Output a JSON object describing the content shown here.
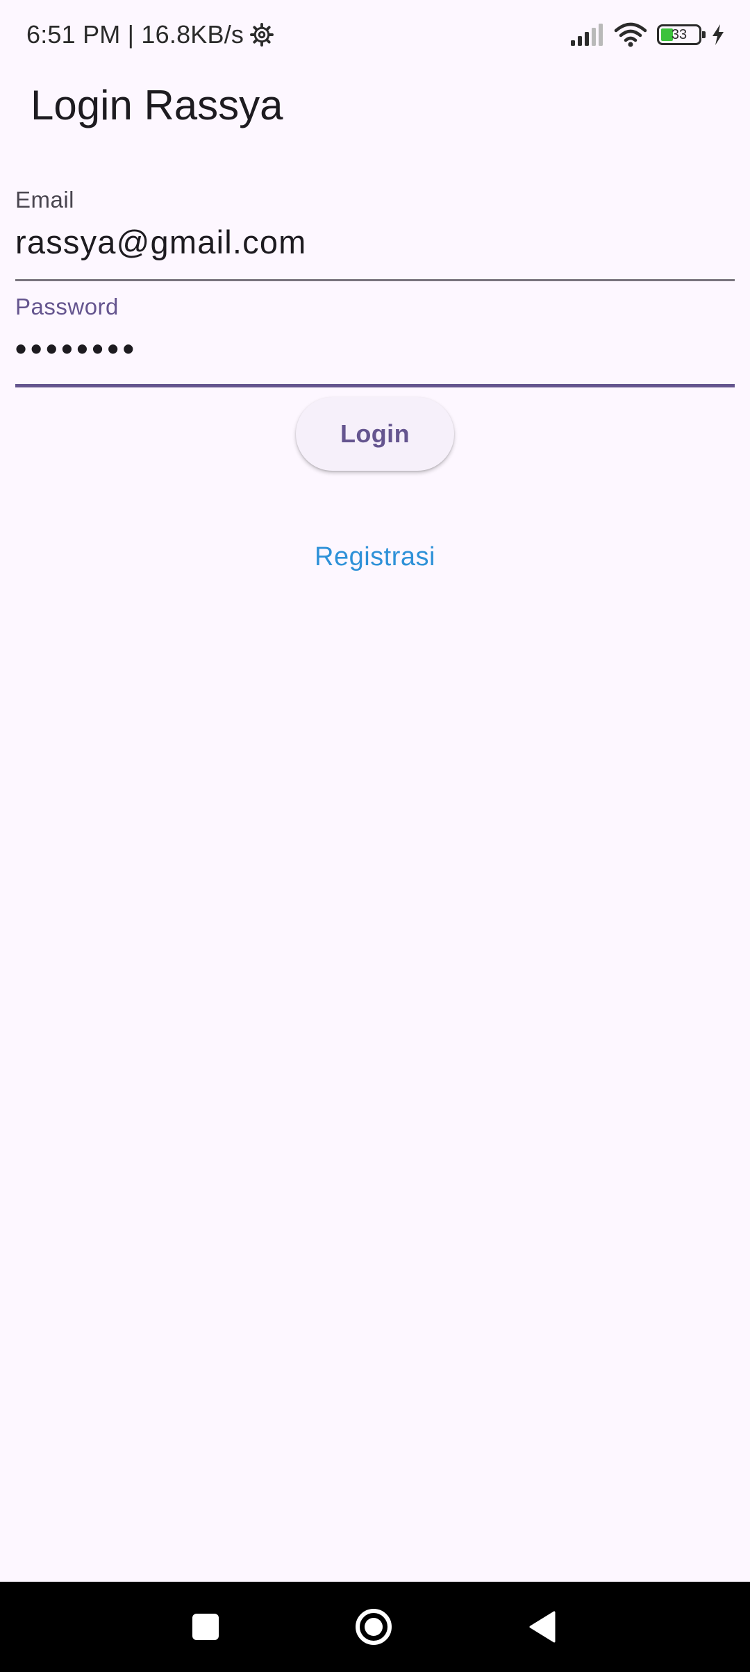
{
  "status_bar": {
    "time_speed": "6:51 PM | 16.8KB/s",
    "battery_level": "33",
    "battery_fraction": 0.33,
    "icons": [
      "gear-icon",
      "signal-icon",
      "wifi-icon",
      "battery-icon",
      "charging-icon"
    ]
  },
  "app_bar": {
    "title": "Login Rassya"
  },
  "form": {
    "email": {
      "label": "Email",
      "value": "rassya@gmail.com"
    },
    "password": {
      "label": "Password",
      "value": "••••••••"
    }
  },
  "buttons": {
    "login_label": "Login",
    "register_label": "Registrasi"
  },
  "nav_bar": {
    "icons": [
      "recents-icon",
      "home-icon",
      "back-icon"
    ]
  },
  "colors": {
    "background": "#FDF7FF",
    "primary": "#65558F",
    "link": "#2E91D8",
    "battery_fill": "#3CC23C",
    "nav_bar": "#000000"
  }
}
